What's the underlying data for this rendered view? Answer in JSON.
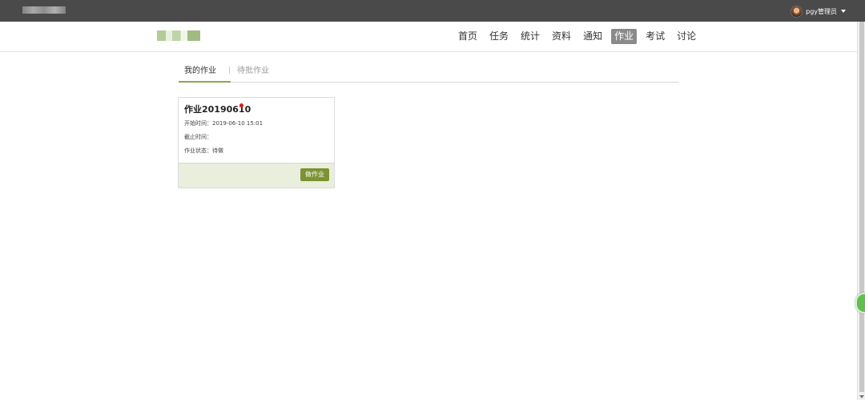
{
  "user": {
    "name": "pgy管理员"
  },
  "nav": {
    "items": [
      {
        "label": "首页",
        "active": false
      },
      {
        "label": "任务",
        "active": false
      },
      {
        "label": "统计",
        "active": false
      },
      {
        "label": "资料",
        "active": false
      },
      {
        "label": "通知",
        "active": false
      },
      {
        "label": "作业",
        "active": true
      },
      {
        "label": "考试",
        "active": false
      },
      {
        "label": "讨论",
        "active": false
      }
    ]
  },
  "tabs": {
    "mine": "我的作业",
    "separator": "|",
    "pending": "待批作业"
  },
  "assignment": {
    "title": "作业20190610",
    "start_label": "开始时间：2019-06-10 15:01",
    "end_label": "截止时间：",
    "status_label": "作业状态：待做",
    "action_label": "做作业"
  },
  "colors": {
    "accent": "#7c9233",
    "topbar": "#4a4a4a",
    "new_indicator": "#e0191e"
  }
}
